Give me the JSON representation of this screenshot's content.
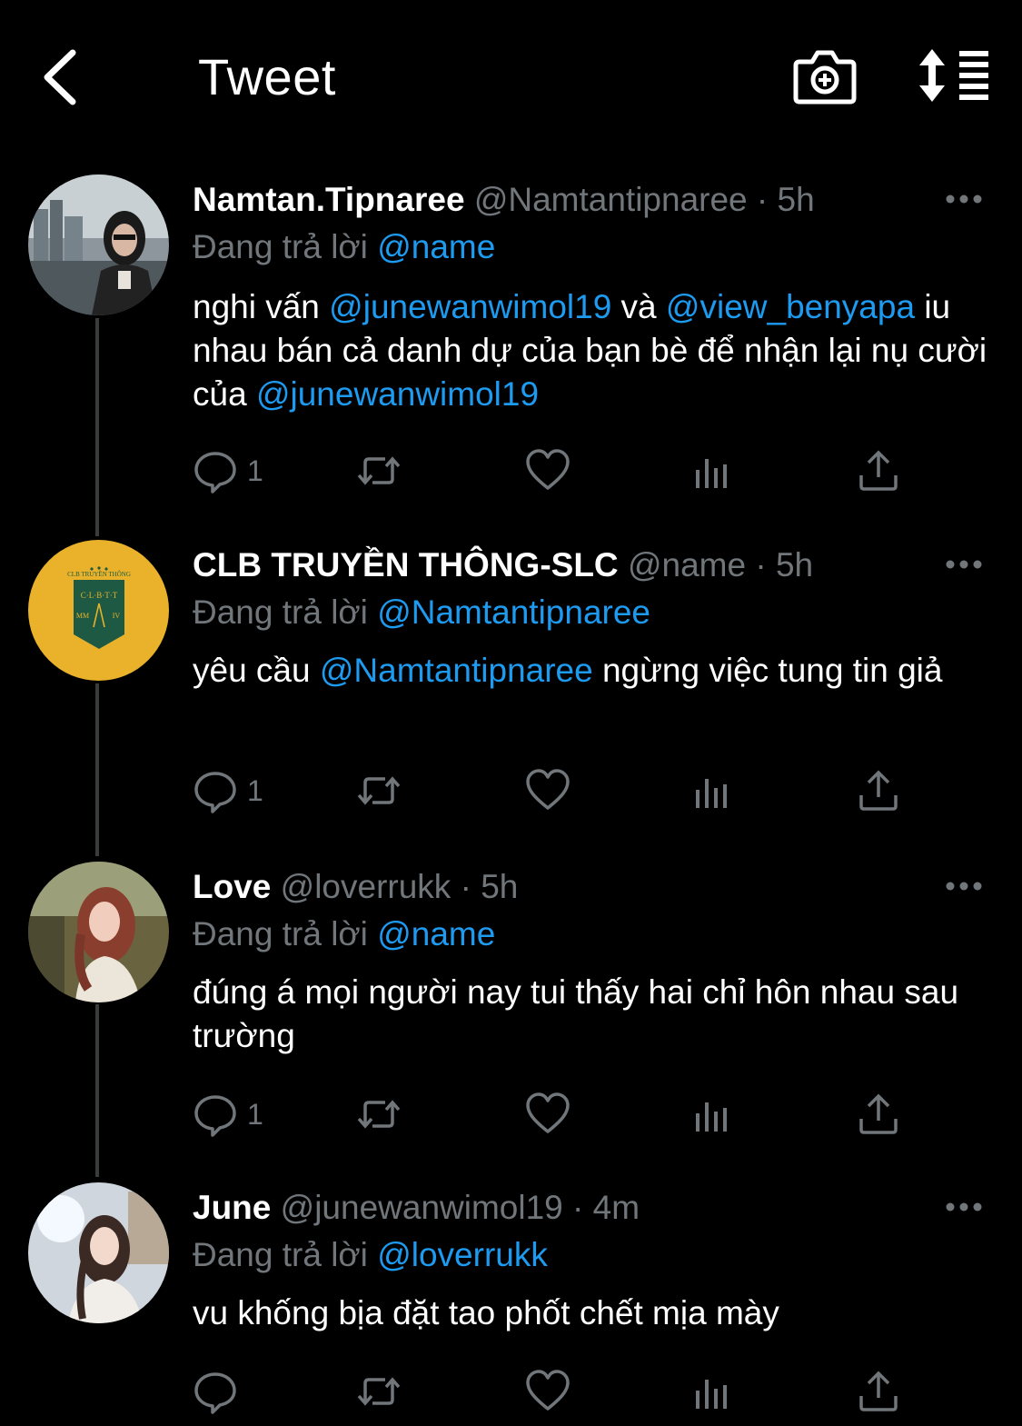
{
  "header": {
    "title": "Tweet"
  },
  "tweets": [
    {
      "name": "Namtan.Tipnaree",
      "handle": "@Namtantipnaree",
      "dot": "·",
      "time": "5h",
      "reply_prefix": "Đang trả lời",
      "reply_to": "@name",
      "body": {
        "t1": "nghi vấn ",
        "m1": "@junewanwimol19",
        "t2": " và ",
        "m2": "@view_benyapa",
        "t3": " iu nhau bán cả danh dự của bạn bè để nhận lại nụ cười của ",
        "m3": "@junewanwimol19"
      },
      "reply_count": "1"
    },
    {
      "name": "CLB TRUYỀN THÔNG-SLC",
      "handle": "@name",
      "dot": "·",
      "time": "5h",
      "reply_prefix": "Đang trả lời",
      "reply_to": "@Namtantipnaree",
      "body": {
        "t1": "yêu cầu ",
        "m1": "@Namtantipnaree",
        "t2": " ngừng việc tung tin giả"
      },
      "reply_count": "1",
      "logo_text": {
        "top": "CLB TRUYỀN THÔNG",
        "middle": "C·L·B·T·T",
        "left": "MM",
        "right": "IV"
      }
    },
    {
      "name": "Love",
      "handle": "@loverrukk",
      "dot": "·",
      "time": "5h",
      "reply_prefix": "Đang trả lời",
      "reply_to": "@name",
      "body": {
        "t1": "đúng á mọi người nay tui thấy hai chỉ hôn nhau sau trường"
      },
      "reply_count": "1"
    },
    {
      "name": "June",
      "handle": "@junewanwimol19",
      "dot": "·",
      "time": "4m",
      "reply_prefix": "Đang trả lời",
      "reply_to": "@loverrukk",
      "body": {
        "t1": "vu khống bịa đặt tao phốt chết mịa mày"
      },
      "reply_count": ""
    }
  ],
  "colors": {
    "background": "#000000",
    "text": "#ffffff",
    "secondary": "#71767b",
    "link": "#1d9bf0",
    "thread_line": "#3a3b3d",
    "logo_yellow": "#e9b22a",
    "logo_green": "#1e5a43"
  },
  "icons": {
    "back": "chevron-left-icon",
    "camera": "camera-plus-icon",
    "sort": "sort-icon",
    "more": "more-dots-icon",
    "reply": "reply-icon",
    "retweet": "retweet-icon",
    "like": "heart-icon",
    "views": "analytics-icon",
    "share": "share-icon"
  }
}
